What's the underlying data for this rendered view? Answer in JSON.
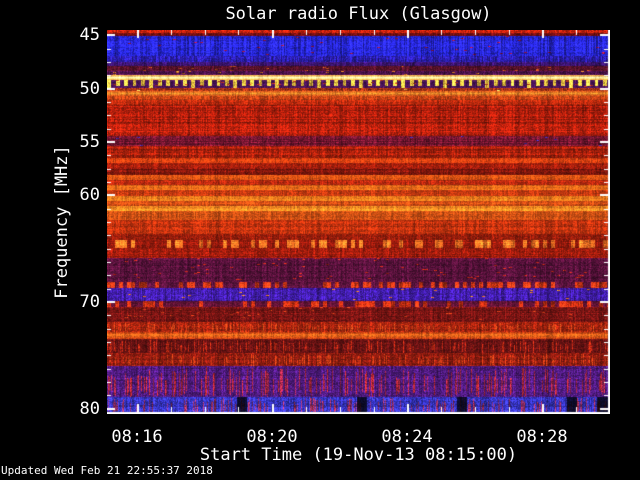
{
  "window": {
    "title": "Solar radio Flux (Glasgow)"
  },
  "footer": {
    "updated": "Updated Wed Feb 21 22:55:37 2018"
  },
  "colors": {
    "background": "#000000",
    "text": "#ffffff",
    "frame": "#ffffff"
  },
  "chart_data": {
    "type": "heatmap",
    "title": "Solar radio Flux (Glasgow)",
    "xlabel": "Start Time (19-Nov-13 08:15:00)",
    "ylabel": "Frequency [MHz]",
    "date": "19-Nov-13",
    "x_start_time": "08:15:00",
    "x_end_time": "08:30:00",
    "x_ticks": [
      {
        "label": "08:16",
        "minute": 16
      },
      {
        "label": "08:20",
        "minute": 20
      },
      {
        "label": "08:24",
        "minute": 24
      },
      {
        "label": "08:28",
        "minute": 28
      }
    ],
    "x_minor_tick_minutes": 1,
    "time_range_min_after_0800": [
      15.11,
      30.0
    ],
    "y_ticks": [
      {
        "label": "45",
        "freq": 45
      },
      {
        "label": "50",
        "freq": 50
      },
      {
        "label": "55",
        "freq": 55
      },
      {
        "label": "60",
        "freq": 60
      },
      {
        "label": "70",
        "freq": 70
      },
      {
        "label": "80",
        "freq": 80
      }
    ],
    "y_minor_tick_mhz": 1.25,
    "freq_range_mhz": [
      44.5,
      80.5
    ],
    "grid": false,
    "legend": "none",
    "bands": [
      {
        "f": [
          44.5,
          44.8
        ],
        "type": "flat",
        "base": [
          210,
          36,
          14
        ],
        "noise": 0.3,
        "rowAmp": 0.1,
        "colAmp": 0.2
      },
      {
        "f": [
          44.8,
          45.1
        ],
        "type": "flat",
        "base": [
          120,
          16,
          18
        ],
        "noise": 0.3,
        "colAmp": 0.2
      },
      {
        "f": [
          45.1,
          46.9
        ],
        "type": "flat",
        "base": [
          38,
          38,
          215
        ],
        "noise": 0.3,
        "colAmp": 0.32,
        "rowAmp": 0.1,
        "sp": 0.012,
        "speckle": [
          150,
          20,
          60
        ]
      },
      {
        "f": [
          46.9,
          47.5
        ],
        "type": "flat",
        "base": [
          42,
          30,
          170
        ],
        "noise": 0.3,
        "colAmp": 0.3
      },
      {
        "f": [
          47.5,
          47.9
        ],
        "type": "flat",
        "base": [
          58,
          20,
          110
        ],
        "noise": 0.3,
        "colAmp": 0.25
      },
      {
        "f": [
          47.9,
          48.3
        ],
        "type": "flat",
        "base": [
          95,
          20,
          45
        ],
        "noise": 0.35,
        "colAmp": 0.2,
        "sp": 0.02,
        "speckle": [
          200,
          80,
          30
        ]
      },
      {
        "f": [
          48.3,
          48.75
        ],
        "type": "flat",
        "base": [
          75,
          18,
          75
        ],
        "noise": 0.4,
        "colAmp": 0.2,
        "sp": 0.02,
        "speckle": [
          220,
          120,
          40
        ]
      },
      {
        "f": [
          48.75,
          49.2
        ],
        "type": "glow",
        "base": [
          245,
          140,
          35
        ],
        "core": [
          255,
          244,
          170
        ],
        "noise": 0.12,
        "colAmp": 0.1
      },
      {
        "f": [
          49.2,
          49.95
        ],
        "type": "fence",
        "base": [
          70,
          18,
          85
        ],
        "core": [
          255,
          210,
          70
        ],
        "noise": 0.3,
        "colAmp": 0.15,
        "sp": 0.03,
        "speckle": [
          180,
          50,
          30
        ]
      },
      {
        "f": [
          49.95,
          50.25
        ],
        "type": "flat",
        "base": [
          175,
          55,
          22
        ],
        "noise": 0.35,
        "colAmp": 0.2,
        "sp": 0.008,
        "speckle": [
          255,
          220,
          90
        ]
      },
      {
        "f": [
          50.25,
          50.65
        ],
        "type": "glow",
        "base": [
          205,
          70,
          22
        ],
        "core": [
          255,
          150,
          45
        ],
        "noise": 0.2,
        "colAmp": 0.15,
        "sp": 0.006,
        "speckle": [
          255,
          225,
          100
        ]
      },
      {
        "f": [
          50.65,
          51.1
        ],
        "type": "flat",
        "base": [
          205,
          70,
          22
        ],
        "noise": 0.25,
        "colAmp": 0.18
      },
      {
        "f": [
          51.1,
          51.5
        ],
        "type": "flat",
        "base": [
          185,
          42,
          14
        ],
        "noise": 0.25,
        "colAmp": 0.18
      },
      {
        "f": [
          51.5,
          54.4
        ],
        "type": "flat",
        "base": [
          182,
          32,
          13
        ],
        "noise": 0.3,
        "colAmp": 0.18,
        "rowAmp": 0.22
      },
      {
        "f": [
          54.4,
          55.4
        ],
        "type": "flat",
        "base": [
          115,
          22,
          48
        ],
        "noise": 0.35,
        "colAmp": 0.2,
        "rowAmp": 0.15,
        "sp": 0.01,
        "speckle": [
          60,
          40,
          160
        ]
      },
      {
        "f": [
          55.4,
          56.5
        ],
        "type": "flat",
        "base": [
          175,
          34,
          13
        ],
        "noise": 0.28,
        "colAmp": 0.18,
        "rowAmp": 0.18
      },
      {
        "f": [
          56.5,
          57.0
        ],
        "type": "flat",
        "base": [
          212,
          62,
          17
        ],
        "noise": 0.25,
        "colAmp": 0.15
      },
      {
        "f": [
          57.0,
          57.45
        ],
        "type": "flat",
        "base": [
          168,
          32,
          13
        ],
        "noise": 0.25,
        "colAmp": 0.15
      },
      {
        "f": [
          57.45,
          58.1
        ],
        "type": "flat",
        "base": [
          132,
          24,
          13
        ],
        "noise": 0.3,
        "colAmp": 0.18,
        "rowAmp": 0.15
      },
      {
        "f": [
          58.1,
          58.6
        ],
        "type": "flat",
        "base": [
          224,
          84,
          20
        ],
        "noise": 0.22,
        "colAmp": 0.15
      },
      {
        "f": [
          58.6,
          59.05
        ],
        "type": "flat",
        "base": [
          178,
          40,
          15
        ],
        "noise": 0.25,
        "colAmp": 0.15
      },
      {
        "f": [
          59.05,
          59.5
        ],
        "type": "flat",
        "base": [
          238,
          108,
          26
        ],
        "noise": 0.2,
        "colAmp": 0.13
      },
      {
        "f": [
          59.5,
          60.1
        ],
        "type": "flat",
        "base": [
          198,
          58,
          17
        ],
        "noise": 0.22,
        "colAmp": 0.15
      },
      {
        "f": [
          60.1,
          60.55
        ],
        "type": "flat",
        "base": [
          246,
          126,
          30
        ],
        "noise": 0.2,
        "colAmp": 0.13
      },
      {
        "f": [
          60.55,
          61.0
        ],
        "type": "flat",
        "base": [
          214,
          78,
          21
        ],
        "noise": 0.22,
        "colAmp": 0.14
      },
      {
        "f": [
          61.0,
          61.5
        ],
        "type": "flat",
        "base": [
          248,
          136,
          34
        ],
        "noise": 0.2,
        "colAmp": 0.13
      },
      {
        "f": [
          61.5,
          62.3
        ],
        "type": "flat",
        "base": [
          220,
          86,
          22
        ],
        "noise": 0.22,
        "colAmp": 0.15,
        "rowAmp": 0.15
      },
      {
        "f": [
          62.3,
          63.6
        ],
        "type": "flat",
        "base": [
          192,
          50,
          15
        ],
        "noise": 0.25,
        "colAmp": 0.16,
        "rowAmp": 0.15
      },
      {
        "f": [
          63.6,
          64.2
        ],
        "type": "flat",
        "base": [
          162,
          32,
          13
        ],
        "noise": 0.28,
        "colAmp": 0.16
      },
      {
        "f": [
          64.2,
          64.95
        ],
        "type": "dashrow",
        "base": [
          146,
          26,
          13
        ],
        "core": [
          252,
          116,
          36
        ],
        "p": 0.4,
        "noise": 0.25,
        "colAmp": 0.15
      },
      {
        "f": [
          64.95,
          65.9
        ],
        "type": "flat",
        "base": [
          156,
          28,
          13
        ],
        "noise": 0.28,
        "colAmp": 0.16,
        "rowAmp": 0.12
      },
      {
        "f": [
          65.9,
          68.1
        ],
        "type": "flat",
        "base": [
          86,
          18,
          58
        ],
        "noise": 0.35,
        "colAmp": 0.2,
        "rowAmp": 0.12,
        "sp": 0.02,
        "speckle": [
          190,
          40,
          26
        ]
      },
      {
        "f": [
          68.1,
          68.7
        ],
        "type": "dashrow",
        "base": [
          92,
          20,
          62
        ],
        "core": [
          214,
          56,
          22
        ],
        "p": 0.42,
        "noise": 0.3,
        "colAmp": 0.18
      },
      {
        "f": [
          68.7,
          69.95
        ],
        "type": "flat",
        "base": [
          66,
          30,
          172
        ],
        "noise": 0.33,
        "colAmp": 0.25,
        "sp": 0.012,
        "speckle": [
          235,
          120,
          40
        ]
      },
      {
        "f": [
          69.95,
          70.5
        ],
        "type": "dashrow",
        "base": [
          98,
          20,
          54
        ],
        "core": [
          212,
          50,
          20
        ],
        "p": 0.45,
        "noise": 0.3,
        "colAmp": 0.18
      },
      {
        "f": [
          70.5,
          71.9
        ],
        "type": "flat",
        "base": [
          124,
          22,
          20
        ],
        "noise": 0.32,
        "colAmp": 0.18,
        "rowAmp": 0.15,
        "sp": 0.015,
        "speckle": [
          210,
          60,
          25
        ]
      },
      {
        "f": [
          71.9,
          72.8
        ],
        "type": "streaks",
        "base": [
          165,
          36,
          15
        ],
        "core": [
          235,
          85,
          28
        ],
        "p": 0.22,
        "noise": 0.3,
        "colAmp": 0.18
      },
      {
        "f": [
          72.8,
          73.5
        ],
        "type": "glow",
        "base": [
          205,
          58,
          16
        ],
        "core": [
          250,
          112,
          30
        ],
        "noise": 0.22,
        "colAmp": 0.15
      },
      {
        "f": [
          73.5,
          74.8
        ],
        "type": "streaks",
        "base": [
          98,
          18,
          18
        ],
        "core": [
          215,
          48,
          20
        ],
        "p": 0.28,
        "noise": 0.32,
        "colAmp": 0.18
      },
      {
        "f": [
          74.8,
          76.0
        ],
        "type": "streaks",
        "base": [
          142,
          28,
          16
        ],
        "core": [
          232,
          72,
          24
        ],
        "p": 0.3,
        "noise": 0.3,
        "colAmp": 0.18
      },
      {
        "f": [
          76.0,
          78.9
        ],
        "type": "streaks",
        "base": [
          76,
          26,
          122
        ],
        "core": [
          205,
          42,
          26
        ],
        "p": 0.34,
        "noise": 0.35,
        "colAmp": 0.2
      },
      {
        "f": [
          78.9,
          80.5
        ],
        "type": "streaks",
        "base": [
          54,
          52,
          192
        ],
        "core": [
          195,
          42,
          44
        ],
        "p": 0.26,
        "noise": 0.35,
        "colAmp": 0.22,
        "dark": 0.14
      }
    ]
  }
}
